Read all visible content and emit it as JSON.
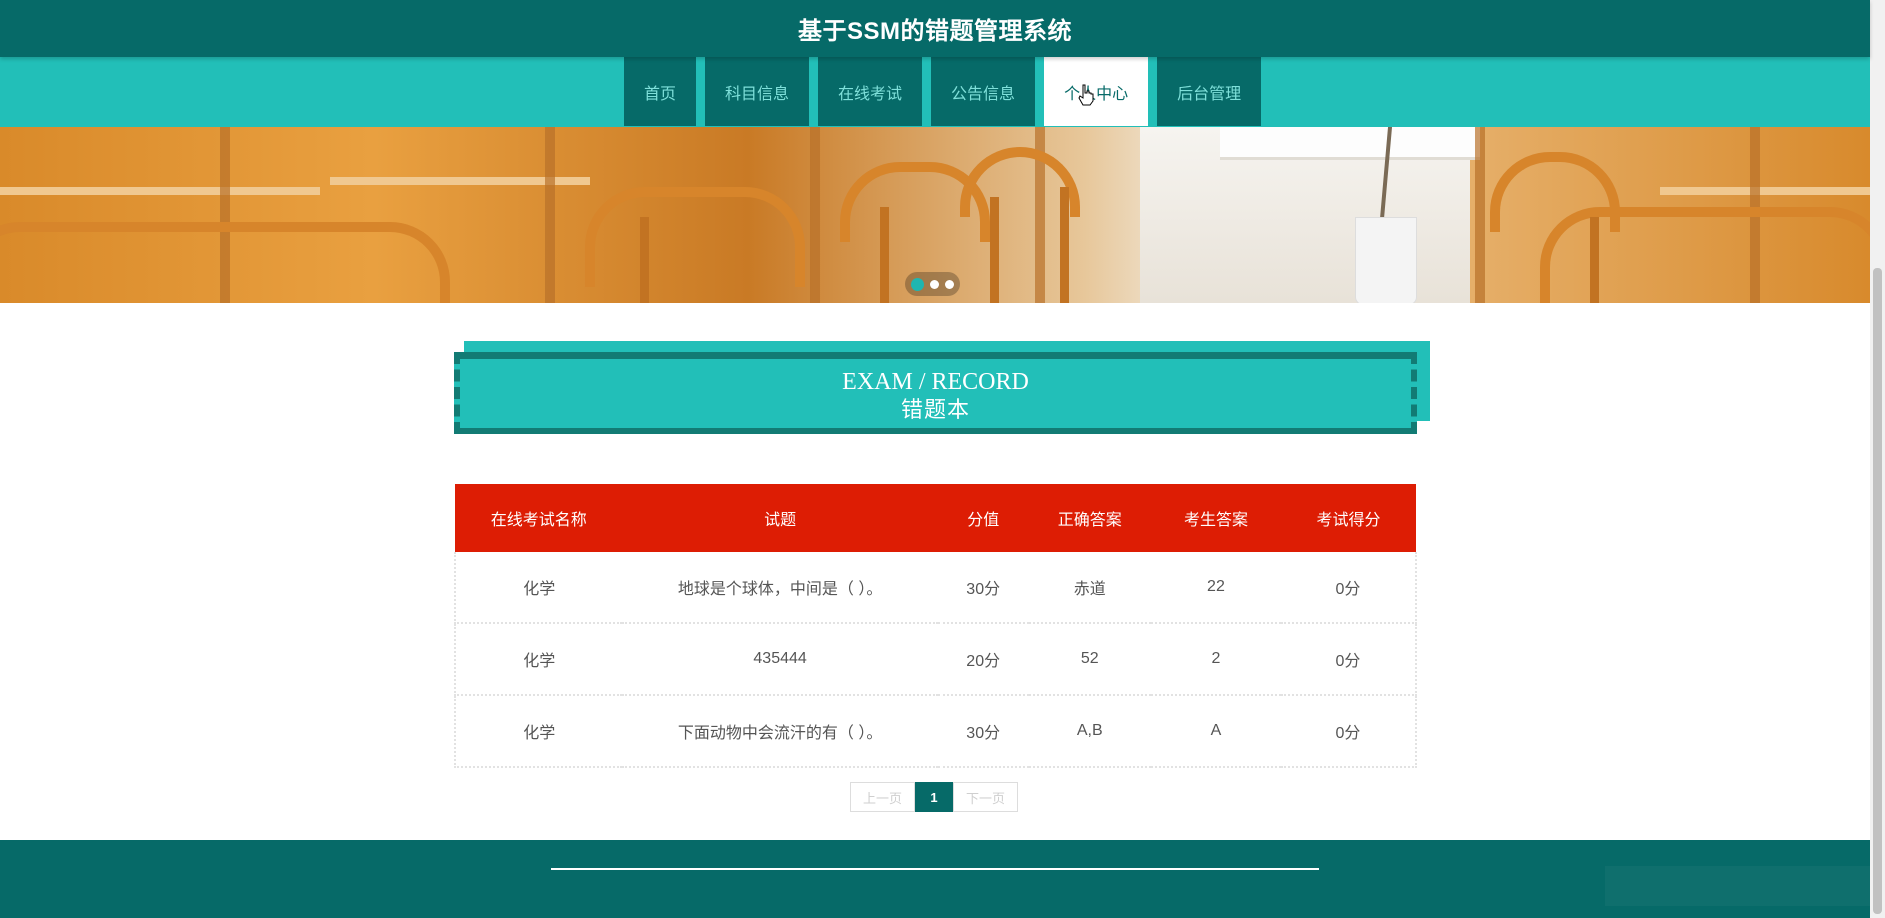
{
  "header": {
    "title": "基于SSM的错题管理系统"
  },
  "nav": {
    "items": [
      {
        "label": "首页"
      },
      {
        "label": "科目信息"
      },
      {
        "label": "在线考试"
      },
      {
        "label": "公告信息"
      },
      {
        "label": "个人中心"
      },
      {
        "label": "后台管理"
      }
    ],
    "active": "个人中心"
  },
  "banner": {
    "slides": 3,
    "active_slide": 1
  },
  "section": {
    "title_en": "EXAM / RECORD",
    "title_cn": "错题本"
  },
  "table": {
    "columns": [
      "在线考试名称",
      "试题",
      "分值",
      "正确答案",
      "考生答案",
      "考试得分"
    ],
    "rows": [
      [
        "化学",
        "地球是个球体，中间是（ ）。",
        "30分",
        "赤道",
        "22",
        "0分"
      ],
      [
        "化学",
        "435444",
        "20分",
        "52",
        "2",
        "0分"
      ],
      [
        "化学",
        "下面动物中会流汗的有（ ）。",
        "30分",
        "A,B",
        "A",
        "0分"
      ]
    ]
  },
  "pagination": {
    "prev": "上一页",
    "current": "1",
    "next": "下一页"
  },
  "colors": {
    "primary_dark": "#066a68",
    "primary": "#22bfb8",
    "table_header": "#dd1d04"
  }
}
